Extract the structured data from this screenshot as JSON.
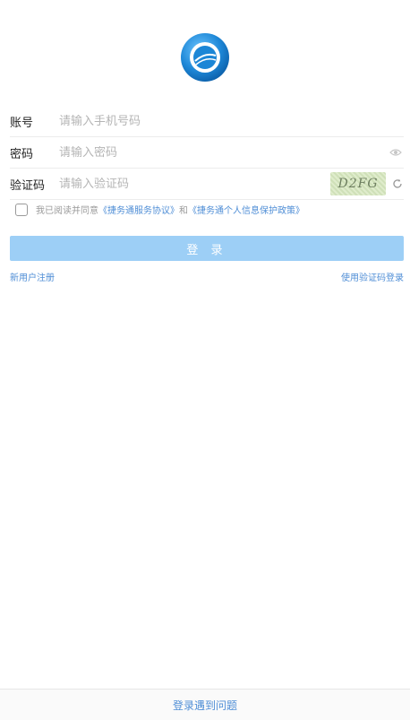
{
  "form": {
    "account_label": "账号",
    "account_placeholder": "请输入手机号码",
    "password_label": "密码",
    "password_placeholder": "请输入密码",
    "captcha_label": "验证码",
    "captcha_placeholder": "请输入验证码",
    "captcha_text": "D2FG"
  },
  "agreement": {
    "prefix": "我已阅读并同意",
    "service_link": "《捷务通服务协议》",
    "and": "和",
    "privacy_link": "《捷务通个人信息保护政策》"
  },
  "login_button": "登 录",
  "links": {
    "register": "新用户注册",
    "sms_login": "使用验证码登录"
  },
  "footer": {
    "help": "登录遇到问题"
  },
  "colors": {
    "accent": "#4f8ed6",
    "button_disabled": "#9dcff6"
  },
  "icons": {
    "logo": "app-logo-icon",
    "eye": "eye-icon",
    "refresh": "refresh-icon",
    "checkbox": "checkbox-icon"
  }
}
